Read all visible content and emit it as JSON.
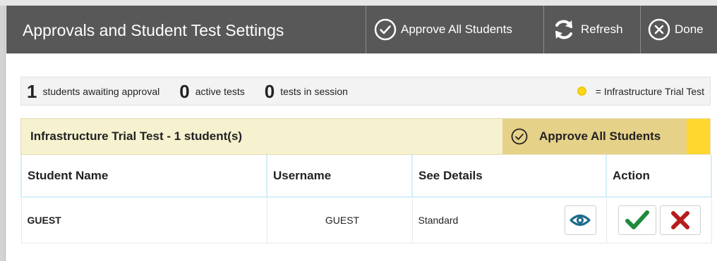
{
  "titlebar": {
    "title": "Approvals and Student Test Settings",
    "approve_all_label": "Approve All Students",
    "refresh_label": "Refresh",
    "done_label": "Done"
  },
  "summary": {
    "awaiting_count": "1",
    "awaiting_label": "students awaiting approval",
    "active_count": "0",
    "active_label": "active tests",
    "session_count": "0",
    "session_label": "tests in session",
    "legend_label": "= Infrastructure Trial Test",
    "legend_color": "#ffd81b"
  },
  "group": {
    "title": "Infrastructure Trial Test - 1 student(s)",
    "approve_all_label": "Approve All Students"
  },
  "table": {
    "columns": [
      "Student Name",
      "Username",
      "See Details",
      "Action"
    ],
    "rows": [
      {
        "name": "GUEST",
        "username": "GUEST",
        "details": "Standard"
      }
    ]
  },
  "colors": {
    "titlebar_bg": "#585858",
    "group_bg": "#f6f1cf",
    "approve_bg": "#e6d189",
    "trial_flag": "#ffd72e",
    "eye_icon": "#1c6b8c",
    "approve_icon": "#1f8a3a",
    "deny_icon": "#b71c1c"
  },
  "icons": {
    "approve_all": "check-circle-icon",
    "refresh": "refresh-icon",
    "done": "close-circle-icon",
    "legend": "yellow-dot-icon",
    "details": "eye-icon",
    "approve": "checkmark-icon",
    "deny": "x-mark-icon"
  }
}
